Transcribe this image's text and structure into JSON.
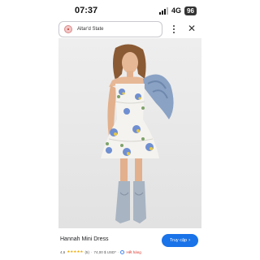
{
  "status_bar": {
    "time": "07:37",
    "network": "4G",
    "battery": "96"
  },
  "browser": {
    "site_name": "Altar'd State",
    "site_icon": "store-logo-icon",
    "more_icon": "more-vertical-icon",
    "close_icon": "close-icon",
    "close_glyph": "✕"
  },
  "product": {
    "title": "Hannah Mini Dress",
    "image_icon": "product-photo",
    "visit_label": "Truy cập",
    "visit_arrow": "›",
    "rating": "4,6",
    "stars": "★★★★★",
    "review_count": "(5)",
    "separator": "·",
    "price": "74,00 $ USD*",
    "availability": "Hết hàng"
  },
  "colors": {
    "accent": "#1a73e8",
    "out_of_stock": "#d93025",
    "star": "#f2a900"
  }
}
